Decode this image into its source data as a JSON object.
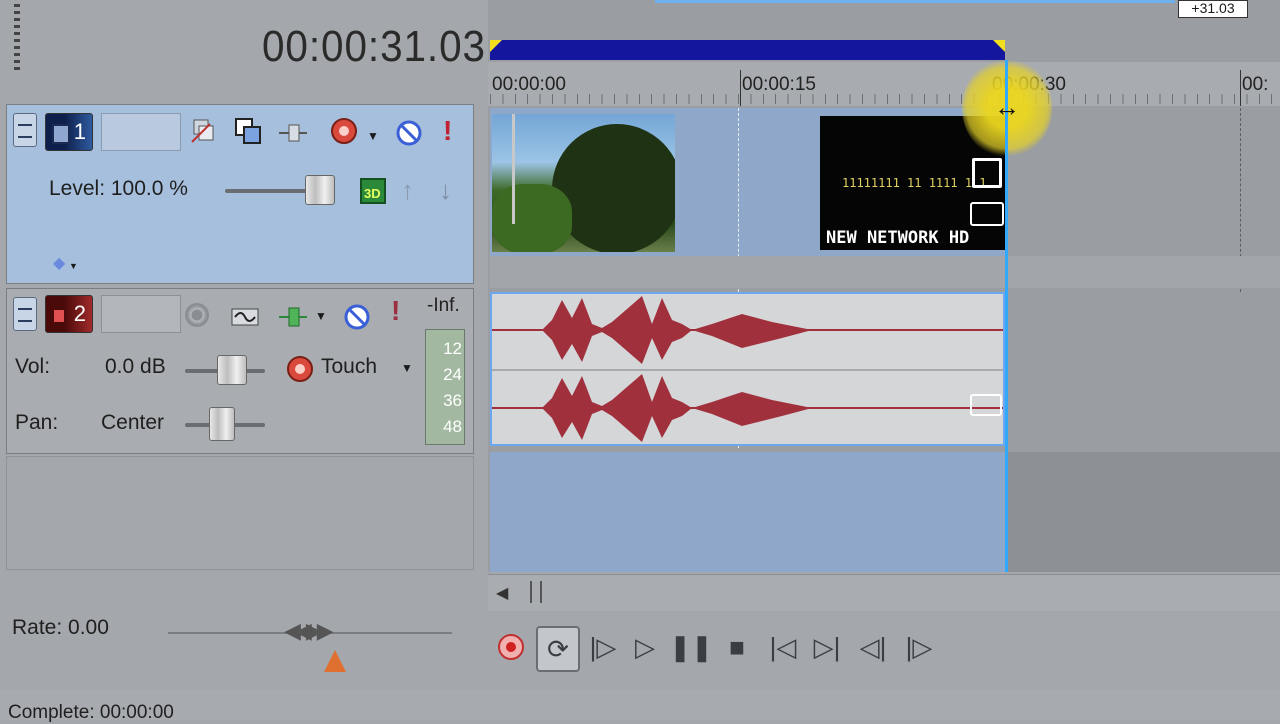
{
  "header": {
    "timecode": "00:00:31.03"
  },
  "video_track": {
    "number": "1",
    "level_label": "Level: 100.0 %",
    "level_percent": 100
  },
  "audio_track": {
    "number": "2",
    "vol_label": "Vol:",
    "vol_value": "0.0 dB",
    "automation_mode": "Touch",
    "pan_label": "Pan:",
    "pan_value": "Center",
    "meter_top": "-Inf.",
    "meter_ticks": [
      "12",
      "24",
      "36",
      "48"
    ]
  },
  "ruler": {
    "ticks": [
      "00:00:00",
      "00:00:15",
      "00:00:30"
    ],
    "partial_tick": "00:"
  },
  "cursor_badge": "+31.03",
  "video_clip": {
    "title_overlay": "NEW NETWORK HD",
    "subtitle_overlay": "11111111 11 1111 1 1"
  },
  "rate": {
    "label": "Rate: 0.00"
  },
  "status": {
    "complete": "Complete: 00:00:00"
  },
  "colors": {
    "region_bar": "#15169e",
    "cursor": "#30a9ff",
    "waveform": "#a0303c",
    "video_track_bg": "#a6bfdc"
  },
  "transport_icons": [
    "record-icon",
    "loop-icon",
    "play-from-start-icon",
    "play-icon",
    "pause-icon",
    "stop-icon",
    "go-to-start-icon",
    "go-to-end-icon",
    "previous-frame-icon",
    "next-frame-icon"
  ]
}
